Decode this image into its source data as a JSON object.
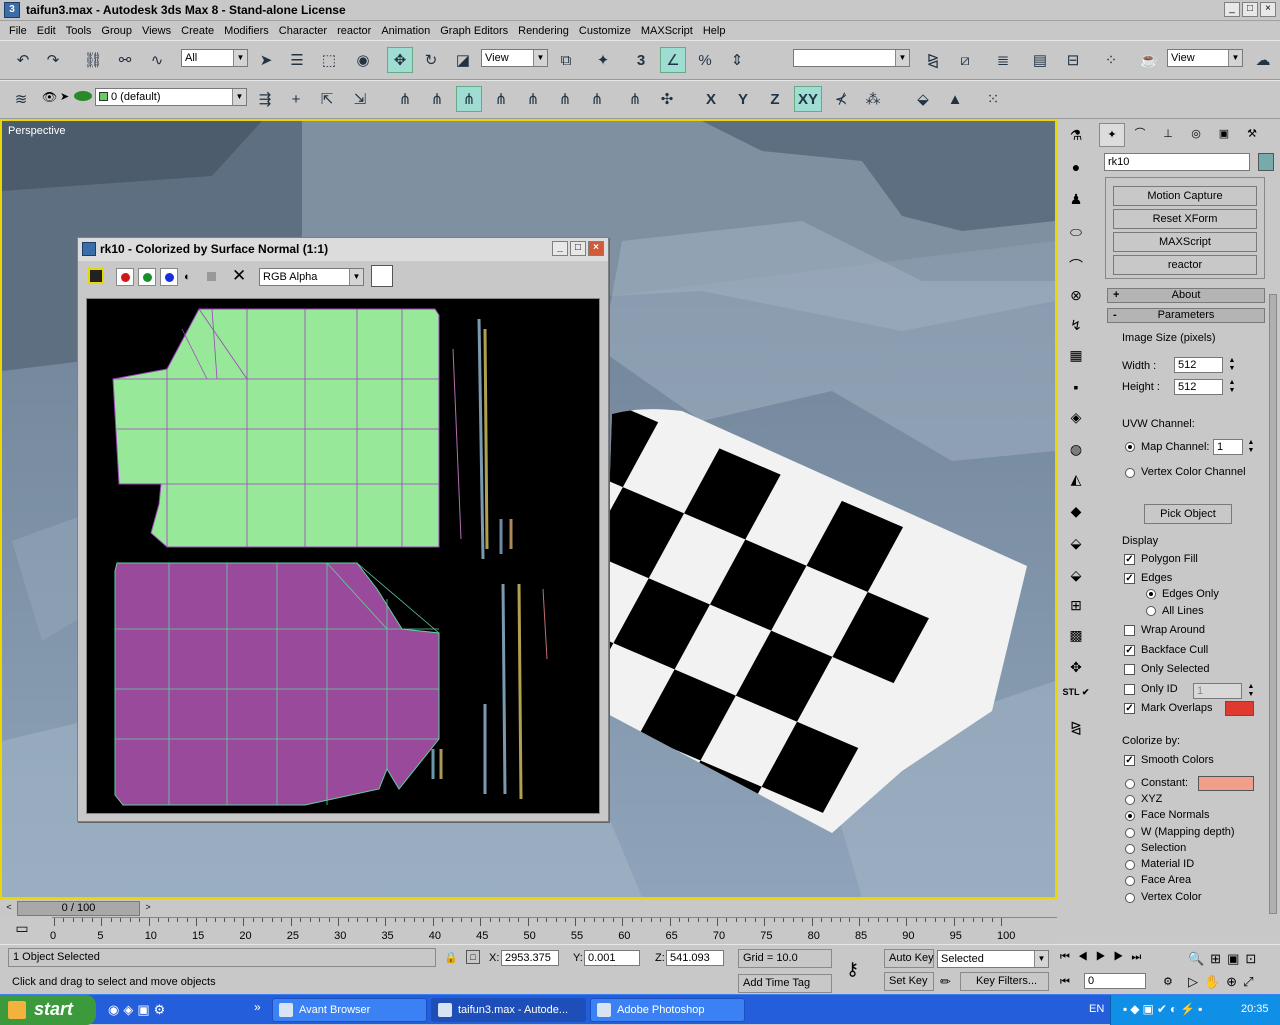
{
  "window": {
    "title": "taifun3.max - Autodesk 3ds Max 8 - Stand-alone License",
    "app_icon": "3dsmax-icon",
    "buttons": [
      "minimize",
      "maximize",
      "close"
    ]
  },
  "menu": [
    "File",
    "Edit",
    "Tools",
    "Group",
    "Views",
    "Create",
    "Modifiers",
    "Character",
    "reactor",
    "Animation",
    "Graph Editors",
    "Rendering",
    "Customize",
    "MAXScript",
    "Help"
  ],
  "toolbar1": {
    "selection_filter": "All",
    "ref_coord": "View",
    "named_selection": "",
    "view_combo2": "View"
  },
  "toolbar2": {
    "layer": "0 (default)",
    "axis_buttons": [
      "X",
      "Y",
      "Z",
      "XY"
    ]
  },
  "viewport": {
    "label": "Perspective"
  },
  "float_window": {
    "title": "rk10 - Colorized by Surface Normal (1:1)",
    "channel": "RGB Alpha"
  },
  "cmd_panel": {
    "object_name": "rk10",
    "utilities": [
      "Motion Capture",
      "Reset XForm",
      "MAXScript",
      "reactor"
    ],
    "rollouts": {
      "about": "About",
      "about_sign": "+",
      "parameters": "Parameters",
      "parameters_sign": "-"
    },
    "params": {
      "image_size_label": "Image Size (pixels)",
      "width_label": "Width :",
      "width_value": "512",
      "height_label": "Height :",
      "height_value": "512",
      "uvw_label": "UVW Channel:",
      "map_channel_label": "Map Channel:",
      "map_channel_value": "1",
      "vertex_color_channel": "Vertex Color Channel",
      "pick_object": "Pick Object",
      "display_label": "Display",
      "polygon_fill": "Polygon Fill",
      "edges": "Edges",
      "edges_only": "Edges Only",
      "all_lines": "All Lines",
      "wrap_around": "Wrap Around",
      "backface_cull": "Backface Cull",
      "only_selected": "Only Selected",
      "only_id": "Only ID",
      "only_id_value": "1",
      "mark_overlaps": "Mark Overlaps",
      "mark_overlaps_color": "#e03a30",
      "colorize_by_label": "Colorize by:",
      "smooth_colors": "Smooth Colors",
      "constant": "Constant:",
      "constant_color": "#f0a08a",
      "xyz": "XYZ",
      "face_normals": "Face Normals",
      "w_mapping": "W (Mapping depth)",
      "selection": "Selection",
      "material_id": "Material ID",
      "face_area": "Face Area",
      "vertex_color": "Vertex Color"
    }
  },
  "timeline": {
    "slider": "0 / 100",
    "ticks": [
      "0",
      "5",
      "10",
      "15",
      "20",
      "25",
      "30",
      "35",
      "40",
      "45",
      "50",
      "55",
      "60",
      "65",
      "70",
      "75",
      "80",
      "85",
      "90",
      "95",
      "100"
    ]
  },
  "status": {
    "selected": "1 Object Selected",
    "prompt": "Click and drag to select and move objects",
    "x_label": "X:",
    "x": "2953.375",
    "y_label": "Y:",
    "y": "0.001",
    "z_label": "Z:",
    "z": "541.093",
    "grid": "Grid = 10.0",
    "add_time_tag": "Add Time Tag",
    "auto_key": "Auto Key",
    "set_key": "Set Key",
    "key_mode": "Selected",
    "key_filters": "Key Filters...",
    "frame": "0"
  },
  "taskbar": {
    "start": "start",
    "tasks": [
      "Avant Browser",
      "taifun3.max - Autode...",
      "Adobe Photoshop"
    ],
    "lang": "EN",
    "clock": "20:35"
  },
  "colors": {
    "viewport_border": "#e8d800",
    "uv_top": "#98e89a",
    "uv_bottom": "#9a4a9a",
    "active_tool": "#9fdcd2"
  }
}
